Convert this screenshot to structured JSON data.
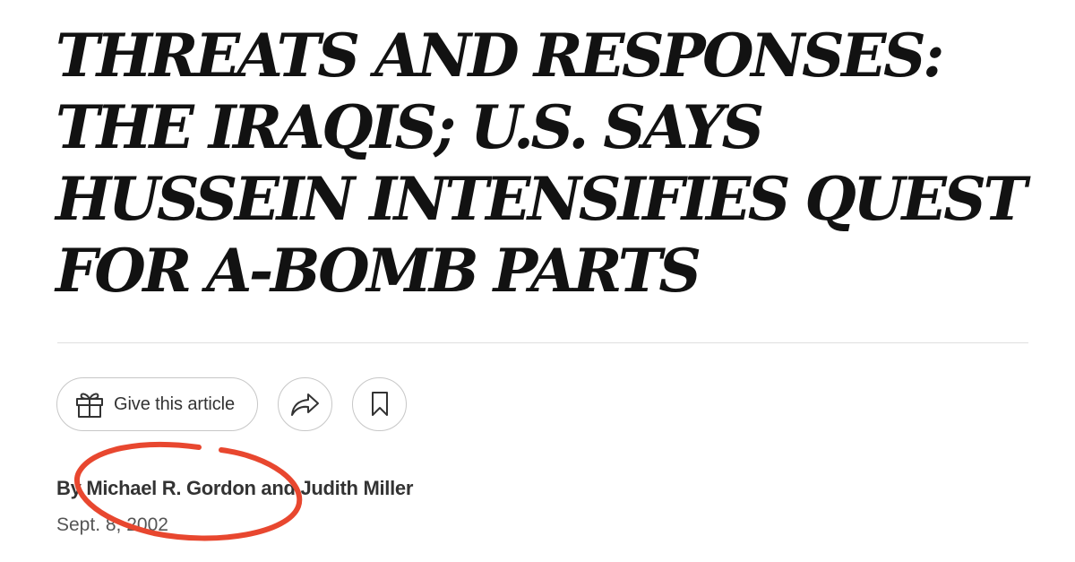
{
  "article": {
    "headline": "THREATS AND RESPONSES: THE IRAQIS; U.S. SAYS HUSSEIN INTENSIFIES QUEST FOR A-BOMB PARTS",
    "byline": {
      "prefix": "By ",
      "author1": "Michael R. Gordon",
      "conjunction": " and ",
      "author2": "Judith Miller"
    },
    "date": "Sept. 8, 2002"
  },
  "toolbar": {
    "gift_label": "Give this article",
    "gift_icon": "gift-icon",
    "share_icon": "share-arrow-icon",
    "save_icon": "bookmark-icon"
  },
  "colors": {
    "text": "#121212",
    "annotation": "#e8472f",
    "rule": "#dfdfdf",
    "button_border": "#c7c7c7"
  }
}
